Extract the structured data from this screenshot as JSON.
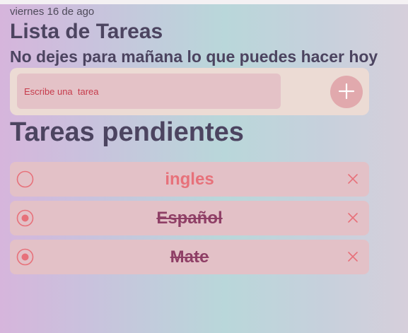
{
  "header": {
    "date": "viernes 16 de ago",
    "title": "Lista de Tareas",
    "subtitle": "No dejes para mañana lo que puedes hacer hoy"
  },
  "form": {
    "placeholder": "Escribe una  tarea",
    "add_icon": "plus-icon"
  },
  "tasks_section": {
    "title": "Tareas pendientes",
    "items": [
      {
        "label": "ingles",
        "done": false
      },
      {
        "label": "Español",
        "done": true
      },
      {
        "label": "Mate",
        "done": true
      }
    ]
  },
  "colors": {
    "accent": "#e7717a",
    "done_text": "#8f3f66",
    "heading": "#4c4460",
    "card": "#e3c1c7"
  }
}
